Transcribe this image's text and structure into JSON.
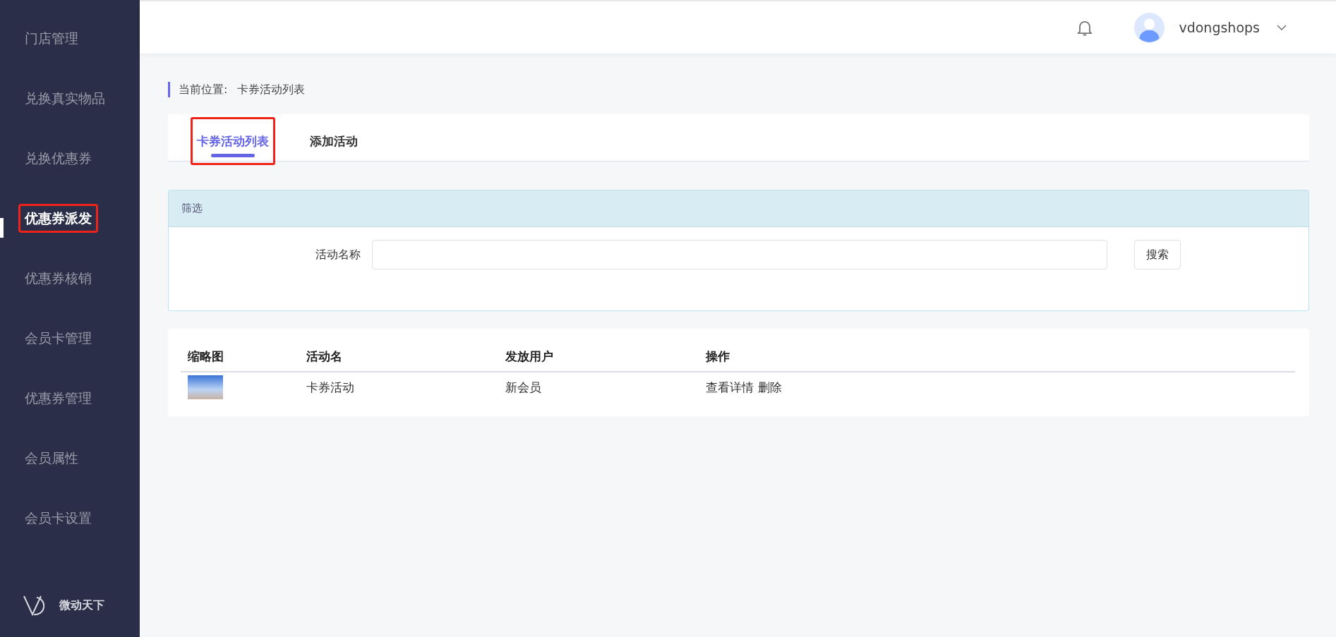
{
  "sidebar": {
    "items": [
      {
        "label": "门店管理",
        "selected": false,
        "highlighted": false
      },
      {
        "label": "兑换真实物品",
        "selected": false,
        "highlighted": false
      },
      {
        "label": "兑换优惠券",
        "selected": false,
        "highlighted": false
      },
      {
        "label": "优惠券派发",
        "selected": true,
        "highlighted": true
      },
      {
        "label": "优惠券核销",
        "selected": false,
        "highlighted": false
      },
      {
        "label": "会员卡管理",
        "selected": false,
        "highlighted": false
      },
      {
        "label": "优惠券管理",
        "selected": false,
        "highlighted": false
      },
      {
        "label": "会员属性",
        "selected": false,
        "highlighted": false
      },
      {
        "label": "会员卡设置",
        "selected": false,
        "highlighted": false
      }
    ],
    "brand": "微动天下"
  },
  "header": {
    "username": "vdongshops"
  },
  "breadcrumb": {
    "label": "当前位置:",
    "current": "卡券活动列表"
  },
  "tabs": [
    {
      "label": "卡券活动列表",
      "selected": true,
      "highlighted": true
    },
    {
      "label": "添加活动",
      "selected": false,
      "highlighted": false
    }
  ],
  "filter": {
    "title": "筛选",
    "field_label": "活动名称",
    "search_button": "搜索"
  },
  "table": {
    "columns": [
      "缩略图",
      "活动名",
      "发放用户",
      "操作"
    ],
    "rows": [
      {
        "activity": "卡券活动",
        "users": "新会员",
        "actions": [
          "查看详情",
          "删除"
        ]
      }
    ]
  }
}
